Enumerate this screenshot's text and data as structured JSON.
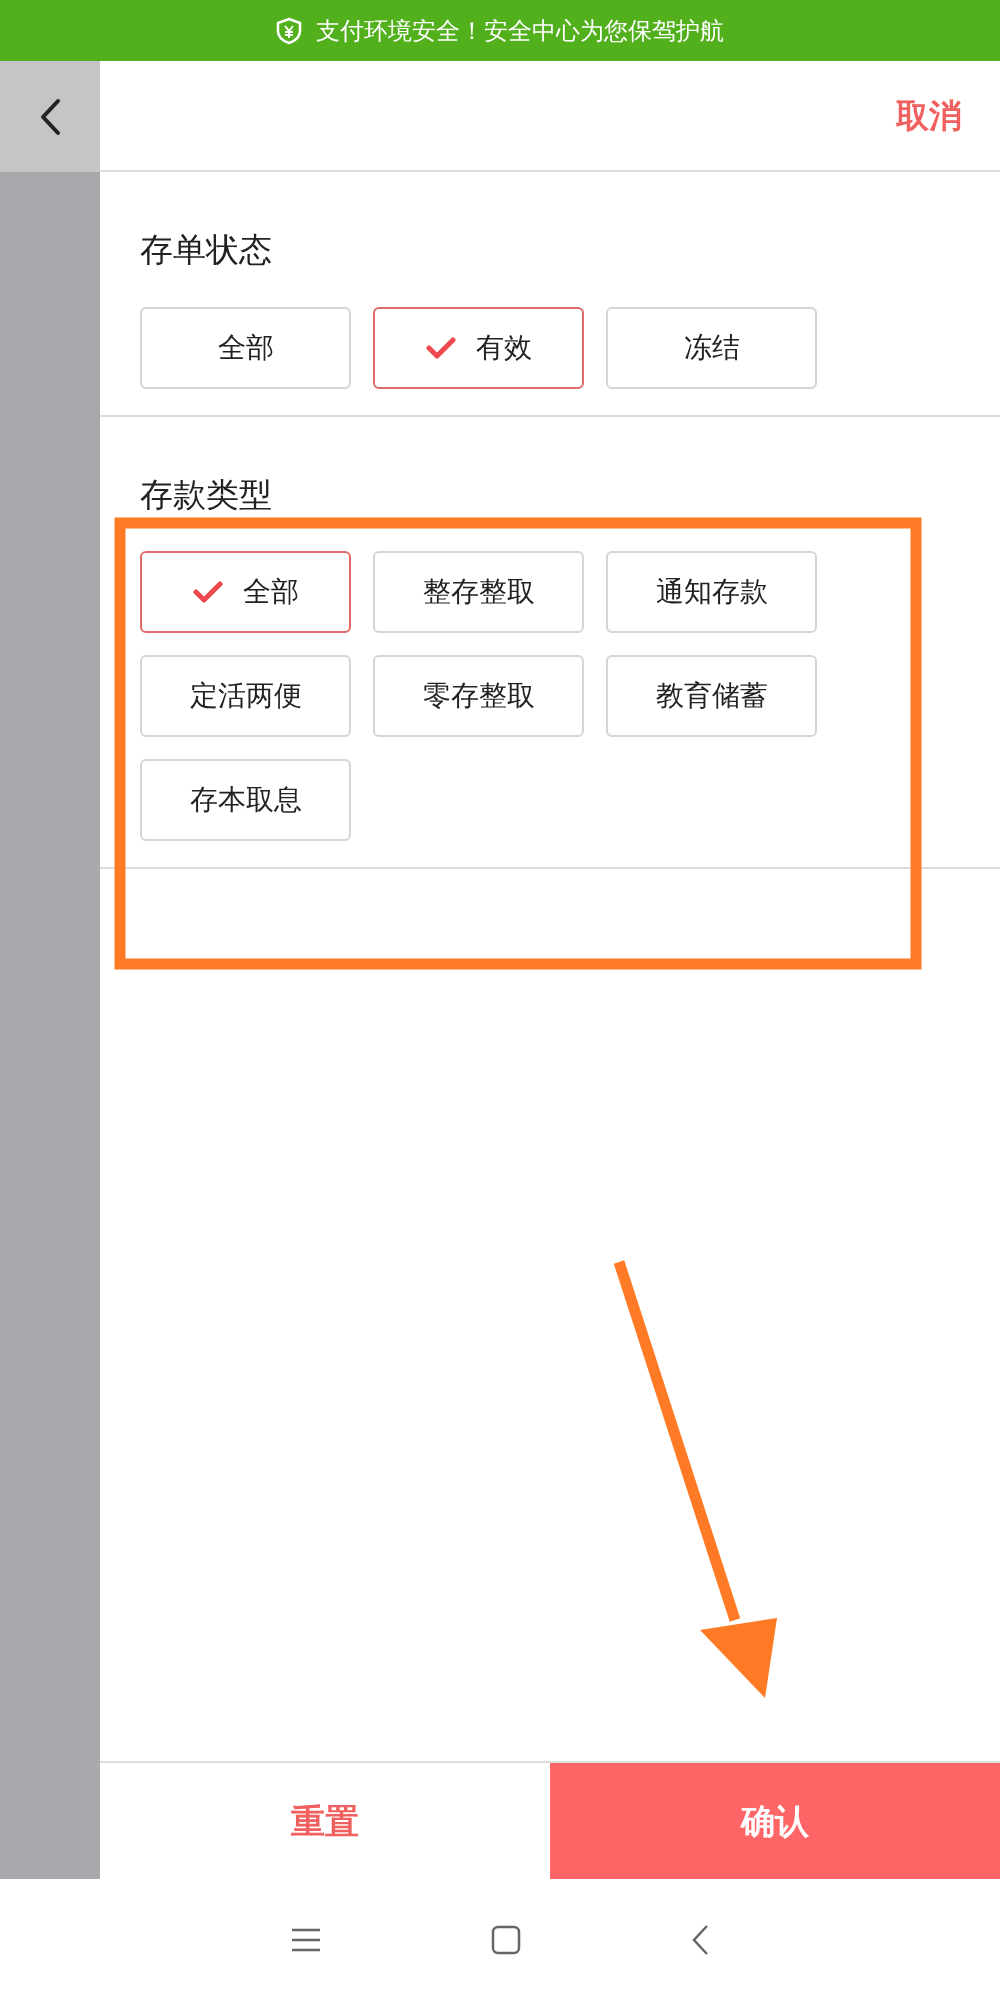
{
  "status_bar": {
    "text": "支付环境安全！安全中心为您保驾护航"
  },
  "header": {
    "cancel": "取消"
  },
  "sections": [
    {
      "title": "存单状态",
      "options": [
        {
          "label": "全部",
          "selected": false
        },
        {
          "label": "有效",
          "selected": true
        },
        {
          "label": "冻结",
          "selected": false
        }
      ]
    },
    {
      "title": "存款类型",
      "options": [
        {
          "label": "全部",
          "selected": true
        },
        {
          "label": "整存整取",
          "selected": false
        },
        {
          "label": "通知存款",
          "selected": false
        },
        {
          "label": "定活两便",
          "selected": false
        },
        {
          "label": "零存整取",
          "selected": false
        },
        {
          "label": "教育储蓄",
          "selected": false
        },
        {
          "label": "存本取息",
          "selected": false
        }
      ]
    }
  ],
  "footer": {
    "reset": "重置",
    "confirm": "确认"
  }
}
